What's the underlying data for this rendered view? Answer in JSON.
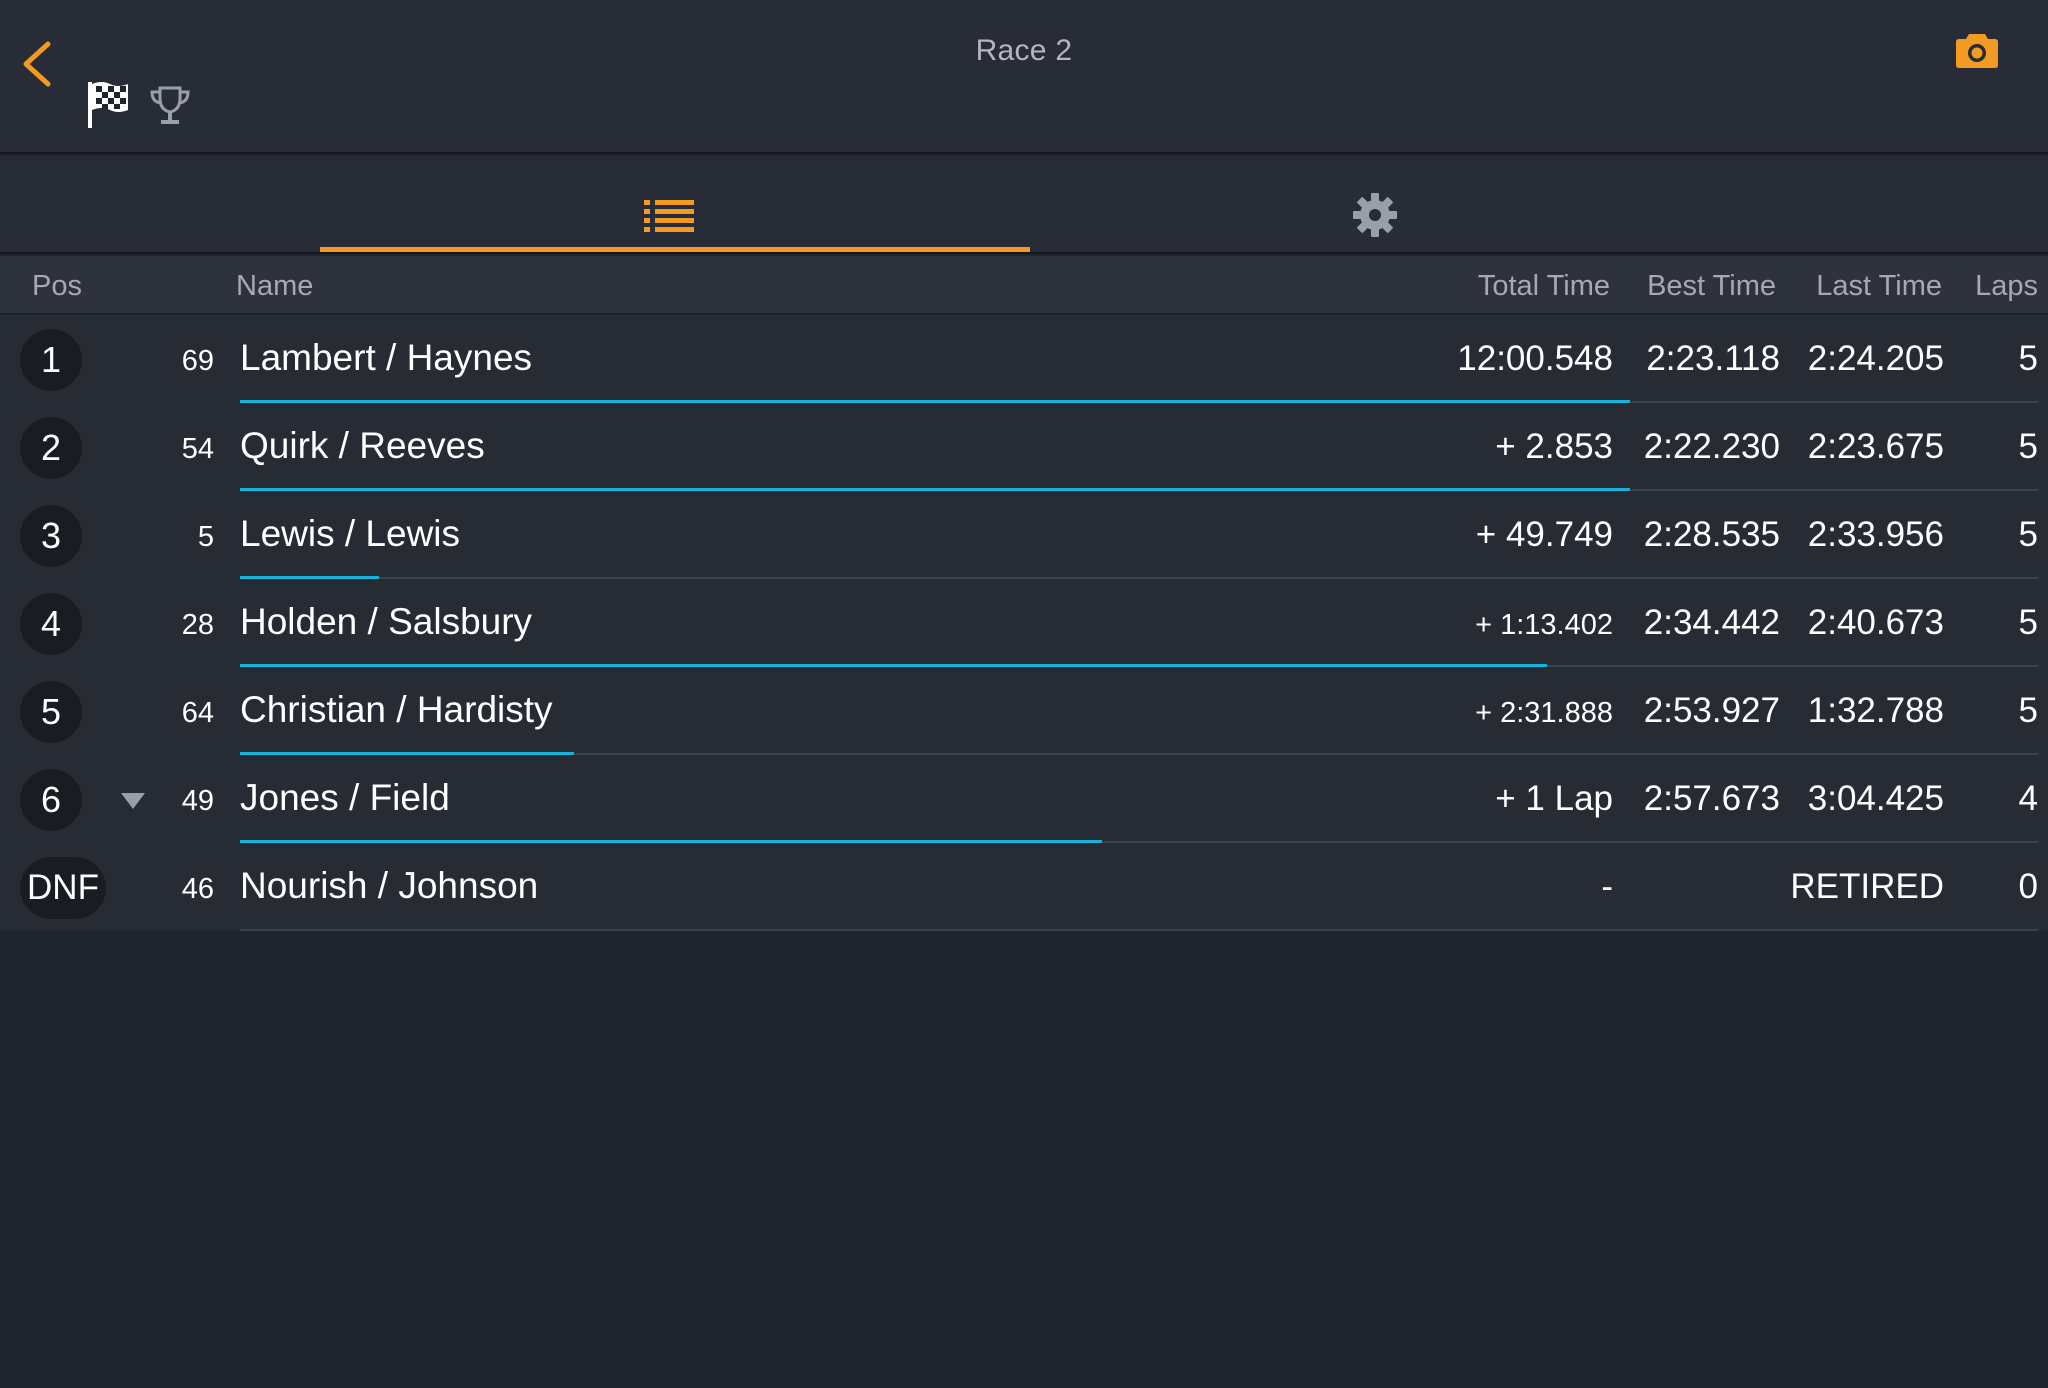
{
  "header": {
    "title": "Race 2",
    "back_icon": "chevron-left-icon",
    "camera_icon": "camera-icon",
    "flag_icon": "checkered-flag-icon",
    "trophy_icon": "trophy-icon"
  },
  "tabs": [
    {
      "name": "results-list",
      "icon": "list-icon",
      "active": true
    },
    {
      "name": "settings",
      "icon": "gear-icon",
      "active": false
    }
  ],
  "columns": {
    "pos": "Pos",
    "name": "Name",
    "total": "Total Time",
    "best": "Best Time",
    "last": "Last Time",
    "laps": "Laps"
  },
  "rows": [
    {
      "pos": "1",
      "car": "69",
      "name": "Lambert / Haynes",
      "total": "12:00.548",
      "best": "2:23.118",
      "last": "2:24.205",
      "laps": "5",
      "progress": 1.0,
      "trend": ""
    },
    {
      "pos": "2",
      "car": "54",
      "name": "Quirk / Reeves",
      "total": "+ 2.853",
      "best": "2:22.230",
      "last": "2:23.675",
      "laps": "5",
      "progress": 1.0,
      "trend": ""
    },
    {
      "pos": "3",
      "car": "5",
      "name": "Lewis / Lewis",
      "total": "+ 49.749",
      "best": "2:28.535",
      "last": "2:33.956",
      "laps": "5",
      "progress": 0.1,
      "trend": ""
    },
    {
      "pos": "4",
      "car": "28",
      "name": "Holden / Salsbury",
      "total": "+ 1:13.402",
      "best": "2:34.442",
      "last": "2:40.673",
      "laps": "5",
      "progress": 0.94,
      "trend": ""
    },
    {
      "pos": "5",
      "car": "64",
      "name": "Christian / Hardisty",
      "total": "+ 2:31.888",
      "best": "2:53.927",
      "last": "1:32.788",
      "laps": "5",
      "progress": 0.24,
      "trend": ""
    },
    {
      "pos": "6",
      "car": "49",
      "name": "Jones / Field",
      "total": "+ 1 Lap",
      "best": "2:57.673",
      "last": "3:04.425",
      "laps": "4",
      "progress": 0.62,
      "trend": "down"
    },
    {
      "pos": "DNF",
      "car": "46",
      "name": "Nourish / Johnson",
      "total": "-",
      "best": "",
      "last": "RETIRED",
      "laps": "0",
      "progress": 0,
      "trend": ""
    }
  ],
  "colors": {
    "accent": "#f39a22",
    "progress": "#15b4dd",
    "background": "#20242c",
    "header": "#272c36"
  }
}
